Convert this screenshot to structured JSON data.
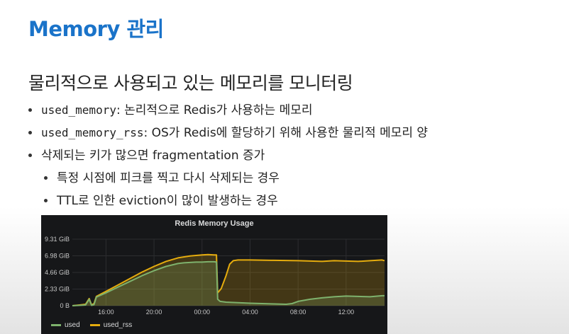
{
  "slide": {
    "title": "Memory 관리",
    "subtitle": "물리적으로 사용되고 있는 메모리를 모니터링",
    "bullets": [
      {
        "code": "used_memory",
        "text": ": 논리적으로 Redis가 사용하는 메모리"
      },
      {
        "code": "used_memory_rss",
        "text": ": OS가 Redis에 할당하기 위해 사용한 물리적 메모리 양"
      },
      {
        "code": "",
        "text": "삭제되는 키가 많으면 fragmentation 증가"
      }
    ],
    "sub_bullets": [
      "특정 시점에 피크를 찍고 다시 삭제되는 경우",
      "TTL로 인한 eviction이 많이 발생하는 경우"
    ]
  },
  "chart_data": {
    "type": "area",
    "title": "Redis Memory Usage",
    "y_ticks": [
      "0 B",
      "2.33 GiB",
      "4.66 GiB",
      "6.98 GiB",
      "9.31 GiB"
    ],
    "y_values": [
      0,
      2.33,
      4.66,
      6.98,
      9.31
    ],
    "ylim": [
      0,
      9.31
    ],
    "x_ticks": [
      "16:00",
      "20:00",
      "00:00",
      "04:00",
      "08:00",
      "12:00"
    ],
    "x_tick_hours": [
      16,
      20,
      24,
      28,
      32,
      36
    ],
    "xlim": [
      13.2,
      39.2
    ],
    "series": [
      {
        "name": "used",
        "color": "#7eb26d",
        "x": [
          13.2,
          13.8,
          14.3,
          14.6,
          14.8,
          15.0,
          15.2,
          16.0,
          17.0,
          18.0,
          19.0,
          20.0,
          21.0,
          22.0,
          22.5,
          23.0,
          23.5,
          24.0,
          24.5,
          25.0,
          25.2,
          25.3,
          25.5,
          26.0,
          28.0,
          30.0,
          31.0,
          31.5,
          32.0,
          33.0,
          34.0,
          35.0,
          36.0,
          37.0,
          38.0,
          39.0,
          39.2
        ],
        "y": [
          0.0,
          0.05,
          0.1,
          0.9,
          0.05,
          0.15,
          1.2,
          1.8,
          2.6,
          3.4,
          4.2,
          4.9,
          5.5,
          5.9,
          6.0,
          6.05,
          6.1,
          6.1,
          6.15,
          6.15,
          6.1,
          0.9,
          0.6,
          0.5,
          0.35,
          0.25,
          0.2,
          0.3,
          0.6,
          0.9,
          1.1,
          1.25,
          1.35,
          1.3,
          1.25,
          1.4,
          1.4
        ]
      },
      {
        "name": "used_rss",
        "color": "#e5ac0e",
        "x": [
          13.2,
          13.8,
          14.3,
          14.6,
          14.8,
          15.0,
          15.2,
          16.0,
          17.0,
          18.0,
          19.0,
          20.0,
          21.0,
          22.0,
          23.0,
          24.0,
          24.5,
          25.0,
          25.2,
          25.3,
          25.6,
          26.0,
          26.3,
          26.6,
          27.0,
          28.0,
          30.0,
          32.0,
          33.0,
          34.0,
          35.0,
          36.0,
          37.0,
          38.0,
          39.0,
          39.2
        ],
        "y": [
          0.0,
          0.1,
          0.2,
          1.0,
          0.1,
          0.3,
          1.3,
          2.0,
          2.9,
          3.8,
          4.7,
          5.5,
          6.2,
          6.7,
          6.95,
          7.1,
          7.15,
          7.1,
          7.1,
          1.8,
          2.4,
          4.2,
          5.8,
          6.3,
          6.4,
          6.4,
          6.35,
          6.3,
          6.25,
          6.2,
          6.3,
          6.25,
          6.2,
          6.3,
          6.4,
          6.3
        ]
      }
    ],
    "legend": "bottom",
    "grid": true
  }
}
